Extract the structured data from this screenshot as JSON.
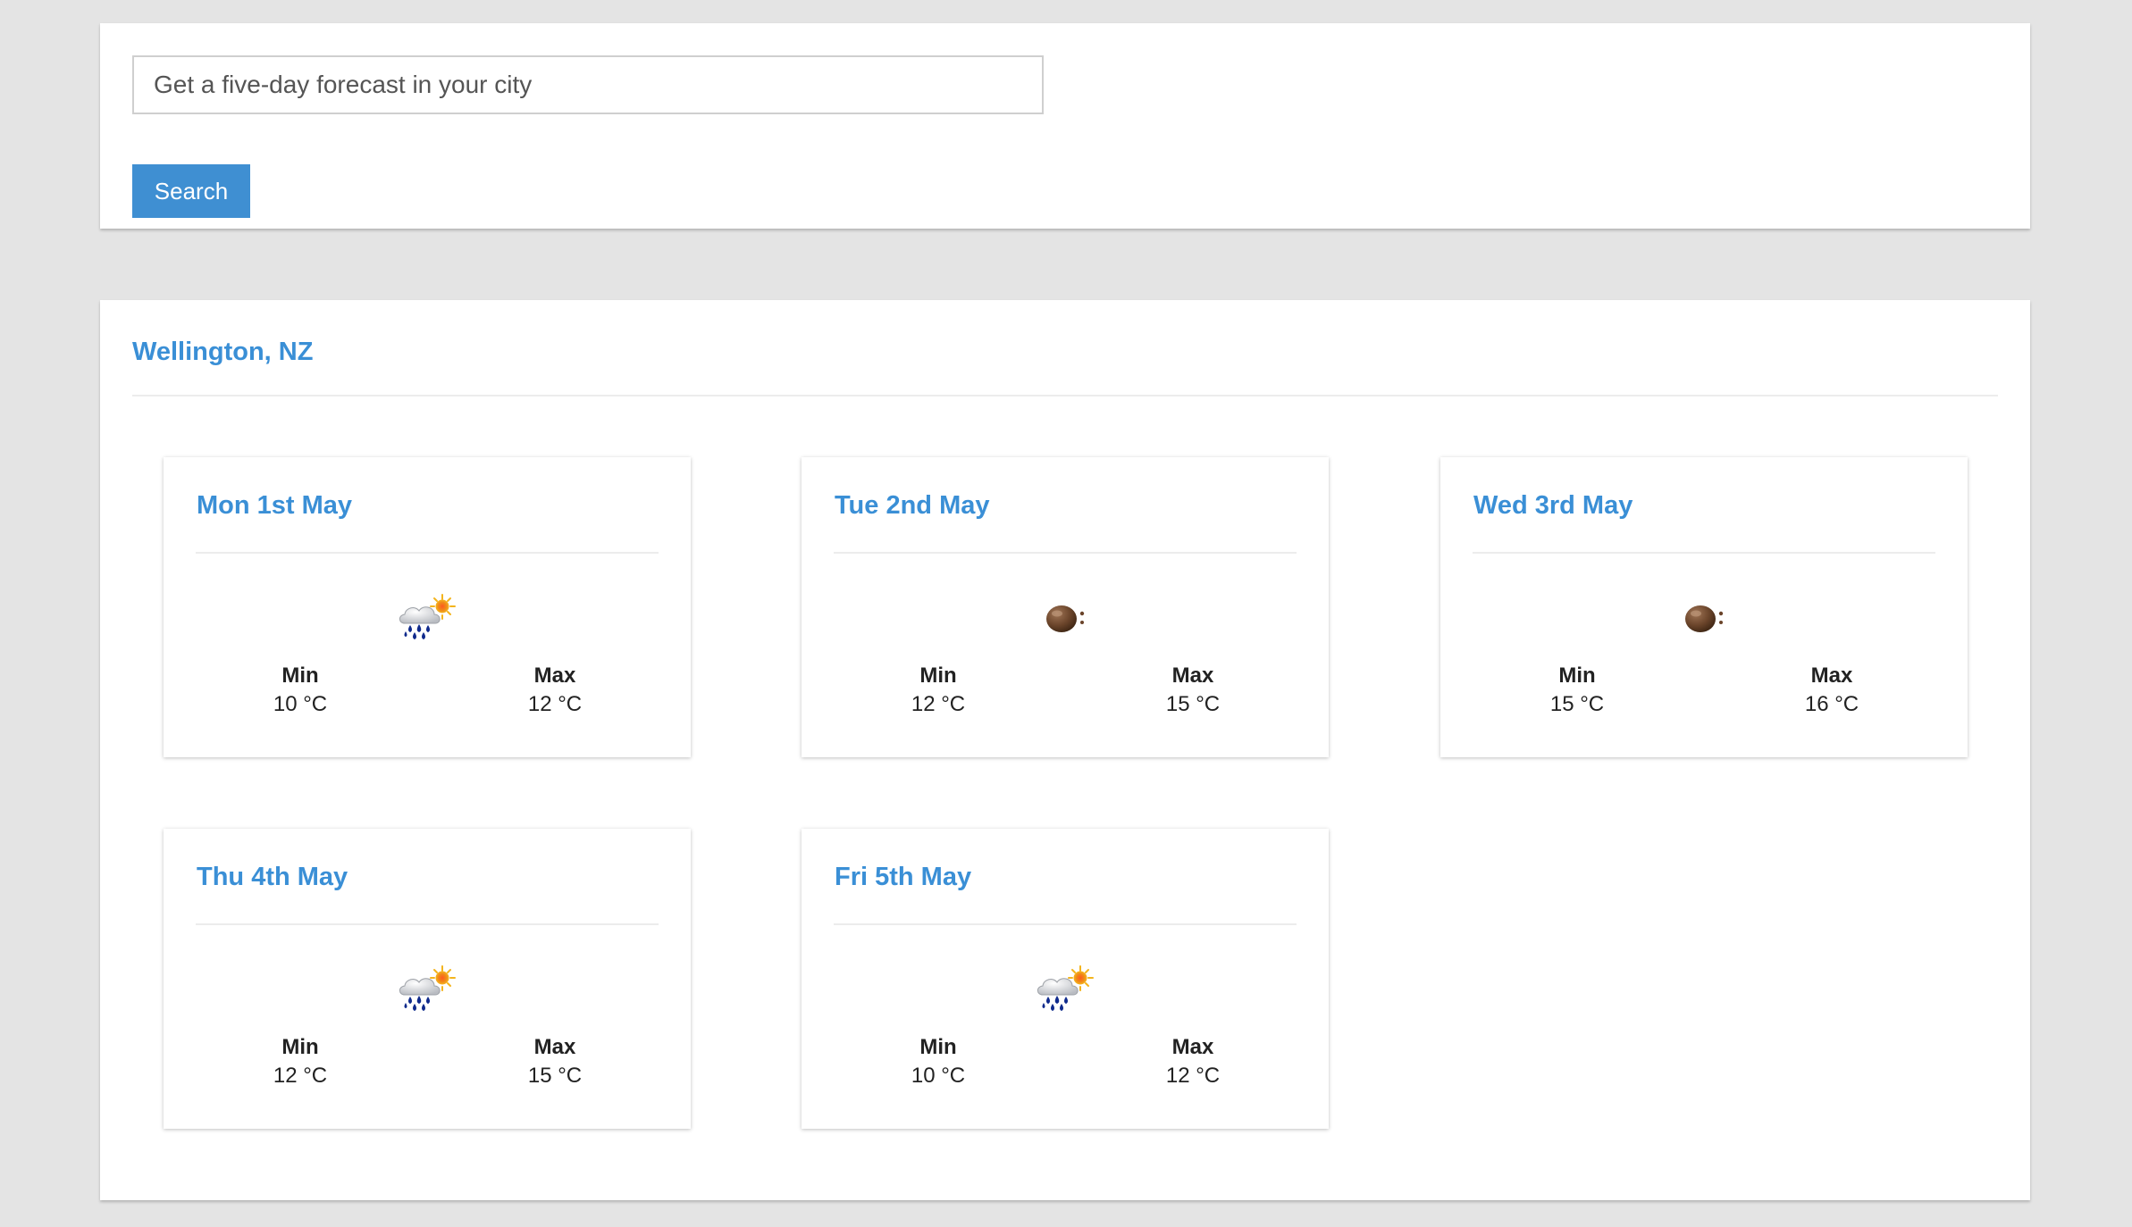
{
  "search": {
    "placeholder": "Get a five-day forecast in your city",
    "button_label": "Search"
  },
  "forecast": {
    "location": "Wellington, NZ",
    "days": [
      {
        "date": "Mon 1st May",
        "icon": "rain-cloud-sun-icon",
        "min_label": "Min",
        "max_label": "Max",
        "min": "10 °C",
        "max": "12 °C"
      },
      {
        "date": "Tue 2nd May",
        "icon": "brown-planet-icon",
        "min_label": "Min",
        "max_label": "Max",
        "min": "12 °C",
        "max": "15 °C"
      },
      {
        "date": "Wed 3rd May",
        "icon": "brown-planet-icon",
        "min_label": "Min",
        "max_label": "Max",
        "min": "15 °C",
        "max": "16 °C"
      },
      {
        "date": "Thu 4th May",
        "icon": "rain-cloud-sun-icon",
        "min_label": "Min",
        "max_label": "Max",
        "min": "12 °C",
        "max": "15 °C"
      },
      {
        "date": "Fri 5th May",
        "icon": "rain-cloud-sun-icon",
        "min_label": "Min",
        "max_label": "Max",
        "min": "10 °C",
        "max": "12 °C"
      }
    ]
  },
  "colors": {
    "background": "#e4e4e4",
    "panel": "#ffffff",
    "accent": "#3a8fd6",
    "button": "#3f8fd2"
  }
}
